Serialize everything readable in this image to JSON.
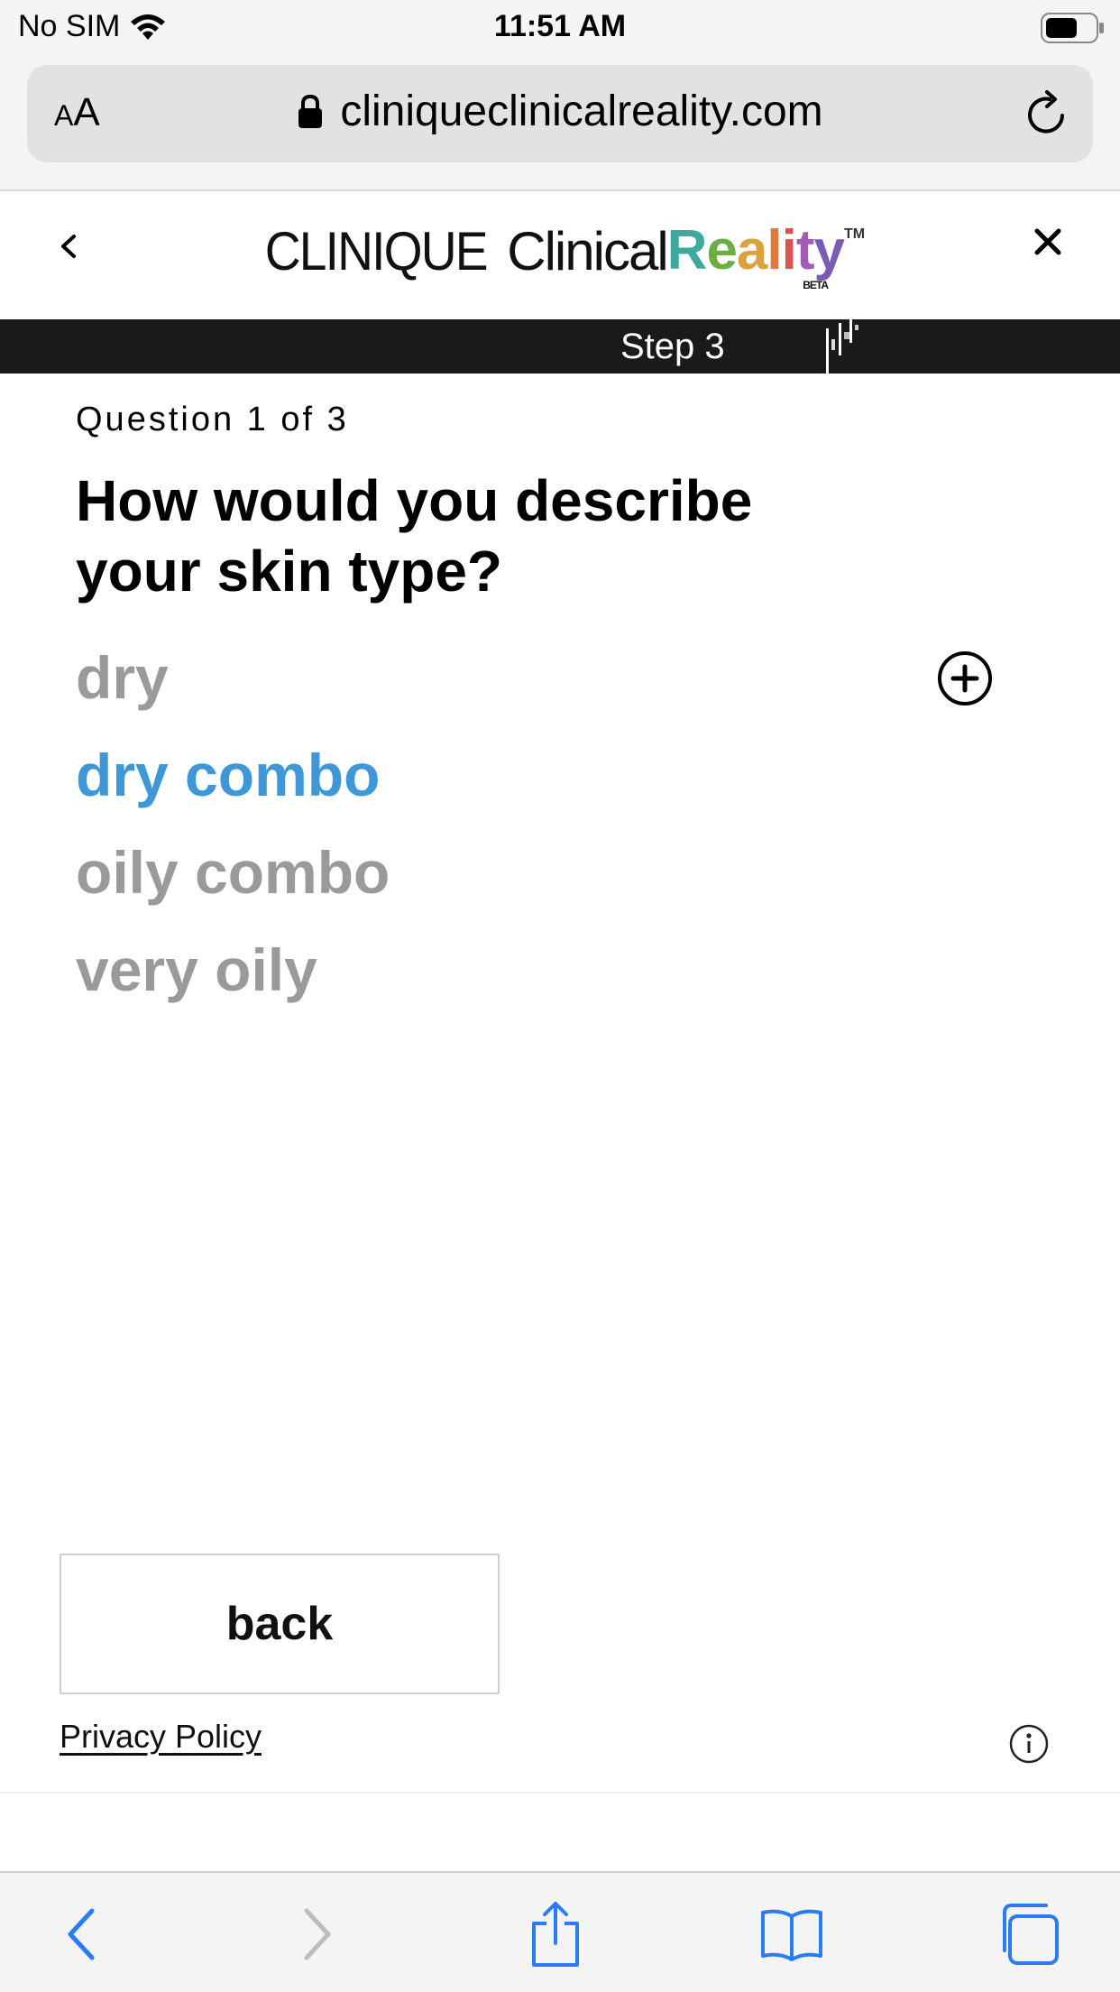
{
  "status": {
    "carrier": "No SIM",
    "time": "11:51 AM"
  },
  "browser": {
    "text_size_label_small": "A",
    "text_size_label_large": "A",
    "url": "cliniqueclinicalreality.com"
  },
  "header": {
    "brand": "CLINIQUE",
    "product": "Clinical",
    "product_highlight_letters": [
      "R",
      "e",
      "a",
      "l",
      "i",
      "t",
      "y"
    ],
    "product_highlight_colors": [
      "#3fa9a0",
      "#6cae45",
      "#d9a23b",
      "#e07a3a",
      "#d9534f",
      "#a25cb4",
      "#7b5cb4"
    ],
    "tm": "TM",
    "beta": "BETA"
  },
  "step": {
    "label": "Step 3"
  },
  "question": {
    "counter": "Question 1 of 3",
    "title": "How would you describe your skin type?",
    "options": [
      "dry",
      "dry combo",
      "oily combo",
      "very oily"
    ],
    "selected_index": 1
  },
  "footer": {
    "back_label": "back",
    "privacy_label": "Privacy Policy"
  },
  "colors": {
    "selected_option": "#3e97d6",
    "unselected_option": "#9a9a9a",
    "safari_blue": "#2a7bf6",
    "step_bar": "#1a1a1a"
  },
  "icons": {
    "expand": "plus-circle-icon",
    "info": "info-icon",
    "back": "chevron-left-icon",
    "close": "close-icon",
    "reload": "reload-icon",
    "lock": "lock-icon",
    "share": "share-icon",
    "bookmarks": "book-icon",
    "tabs": "tabs-icon"
  }
}
